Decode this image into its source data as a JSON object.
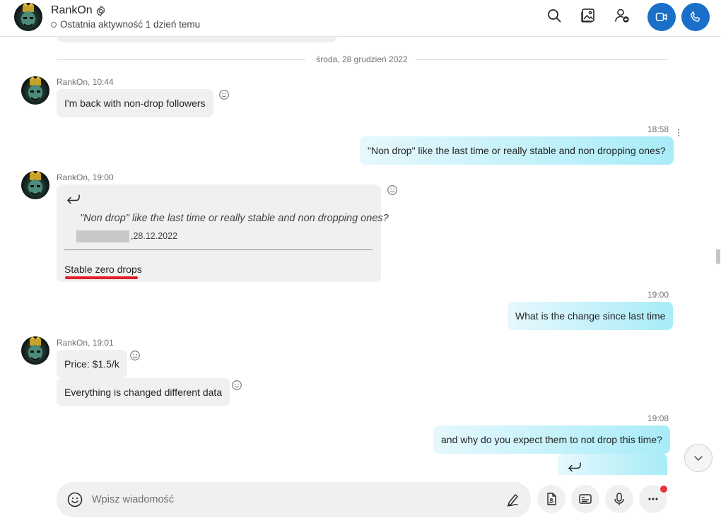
{
  "header": {
    "name": "RankOn",
    "status": "Ostatnia aktywność 1 dzień temu",
    "accent_color": "#1a6fc9"
  },
  "date_separator": "środa, 28 grudzień 2022",
  "messages": {
    "m1": {
      "meta": "RankOn, 10:44",
      "text": "I'm back with non-drop followers"
    },
    "m2": {
      "time": "18:58",
      "text": "\"Non drop\" like the last time or really stable and non dropping ones?"
    },
    "m3": {
      "meta": "RankOn, 19:00",
      "quote_text": "\"Non drop\" like the last time or really stable and non dropping ones?",
      "quote_date": ",28.12.2022",
      "reply": "Stable zero drops"
    },
    "m4": {
      "time": "19:00",
      "text": "What is the change since last time"
    },
    "m5": {
      "meta": "RankOn, 19:01",
      "text": "Price: $1.5/k"
    },
    "m6": {
      "text": "Everything is changed different data"
    },
    "m7": {
      "time": "19:08",
      "text": "and why do you expect them to not drop this time?"
    }
  },
  "composer": {
    "placeholder": "Wpisz wiadomość"
  },
  "icons": {
    "header": [
      "gear-icon",
      "search-icon",
      "gallery-icon",
      "add-person-icon",
      "video-call-icon",
      "phone-call-icon"
    ],
    "composer": [
      "emoji-icon",
      "pen-icon",
      "file-attach-icon",
      "contact-card-icon",
      "microphone-icon",
      "more-icon"
    ],
    "reaction": "smile-reaction-icon",
    "reply": "reply-arrow-icon"
  },
  "colors": {
    "incoming_bubble": "#f0f0f0",
    "outgoing_bubble_start": "#e6f8fd",
    "outgoing_bubble_end": "#a8ecf8",
    "highlight_underline": "#e0202a",
    "notification_dot": "#e8323c"
  }
}
